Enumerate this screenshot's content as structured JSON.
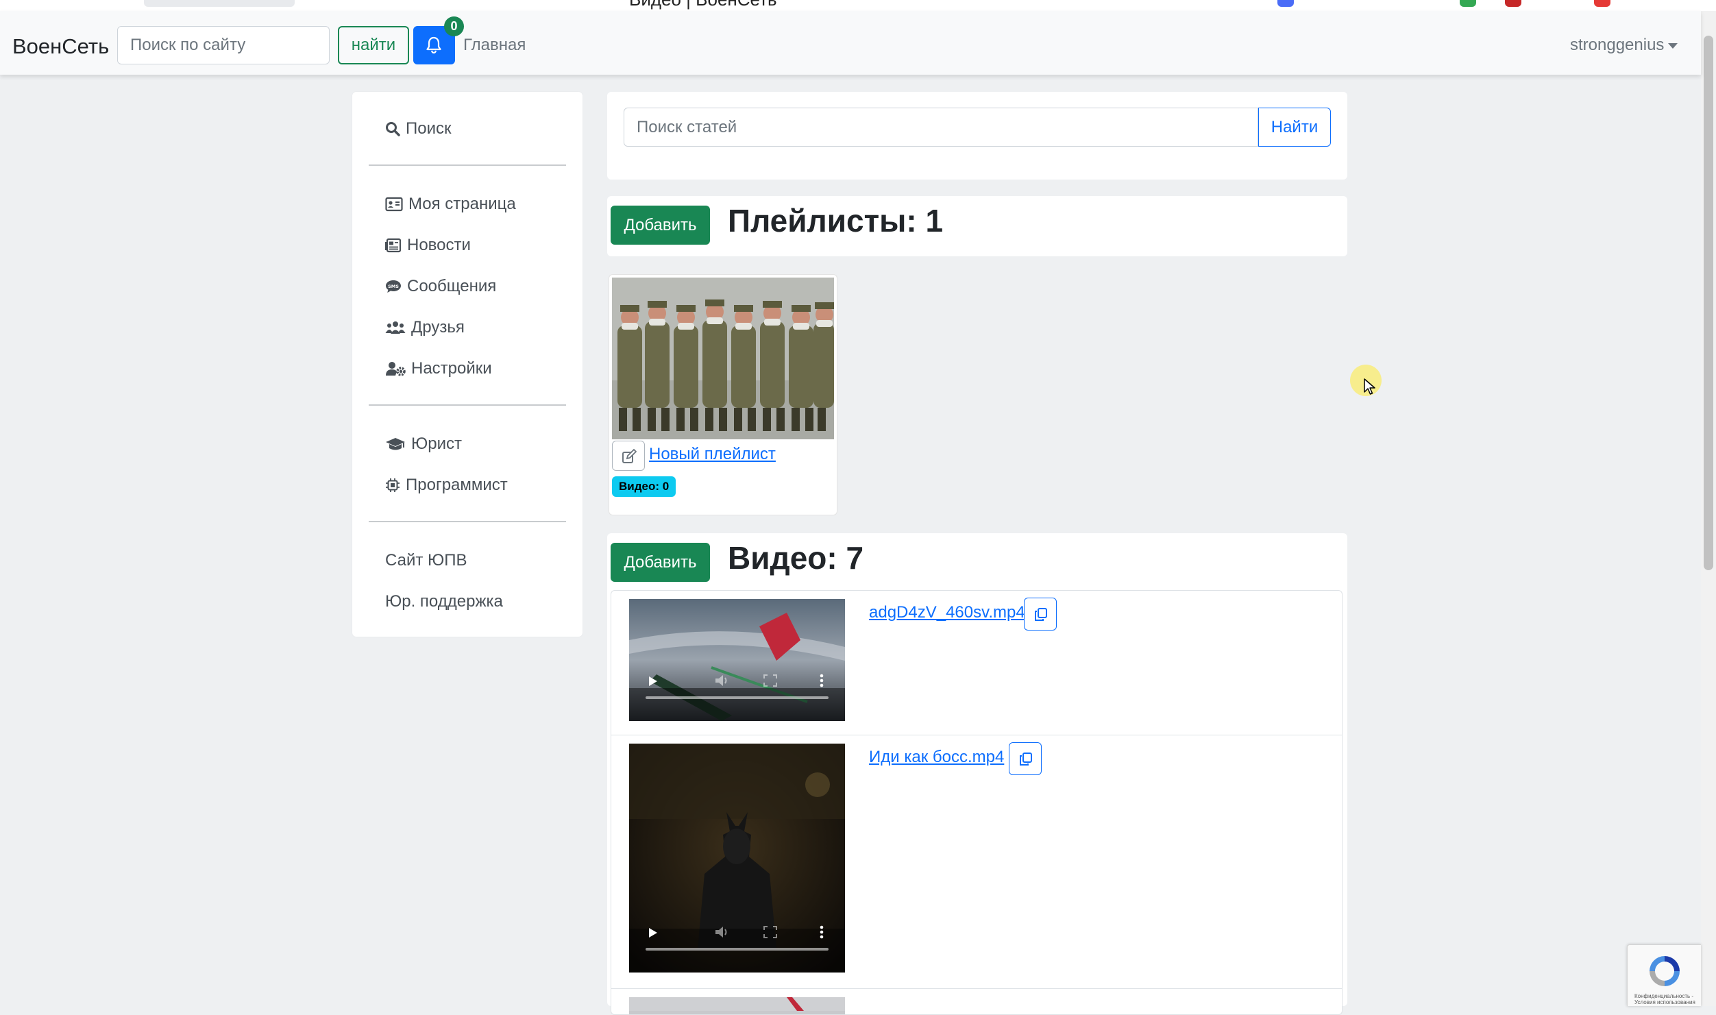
{
  "browser": {
    "tab_url": "test.voenset.ru",
    "page_title": "Видео | ВоенСеть"
  },
  "navbar": {
    "brand": "ВоенСеть",
    "search_placeholder": "Поиск по сайту",
    "search_button": "найти",
    "notifications_count": "0",
    "home_link": "Главная",
    "username": "stronggenius"
  },
  "sidebar": {
    "search": "Поиск",
    "groups": [
      [
        "Моя страница",
        "Новости",
        "Сообщения",
        "Друзья",
        "Настройки"
      ],
      [
        "Юрист",
        "Программист"
      ],
      [
        "Сайт ЮПВ",
        "Юр. поддержка"
      ]
    ]
  },
  "article_search": {
    "placeholder": "Поиск статей",
    "button": "Найти"
  },
  "playlists": {
    "add_button": "Добавить",
    "title": "Плейлисты: 1",
    "items": [
      {
        "name": "Новый плейлист",
        "badge": "Видео: 0"
      }
    ]
  },
  "videos": {
    "add_button": "Добавить",
    "title": "Видео: 7",
    "items": [
      {
        "filename": "adgD4zV_460sv.mp4"
      },
      {
        "filename": "Иди как босс.mp4"
      }
    ]
  },
  "colors": {
    "success": "#198754",
    "primary": "#0d6efd",
    "info": "#0dcaf0",
    "background": "#eef0f2"
  },
  "icons": {
    "notifications": "bell-icon",
    "edit": "pencil-square-icon",
    "copy": "copy-icon"
  },
  "recaptcha": {
    "text_line1": "Конфиденциальность -",
    "text_line2": "Условия использования"
  }
}
